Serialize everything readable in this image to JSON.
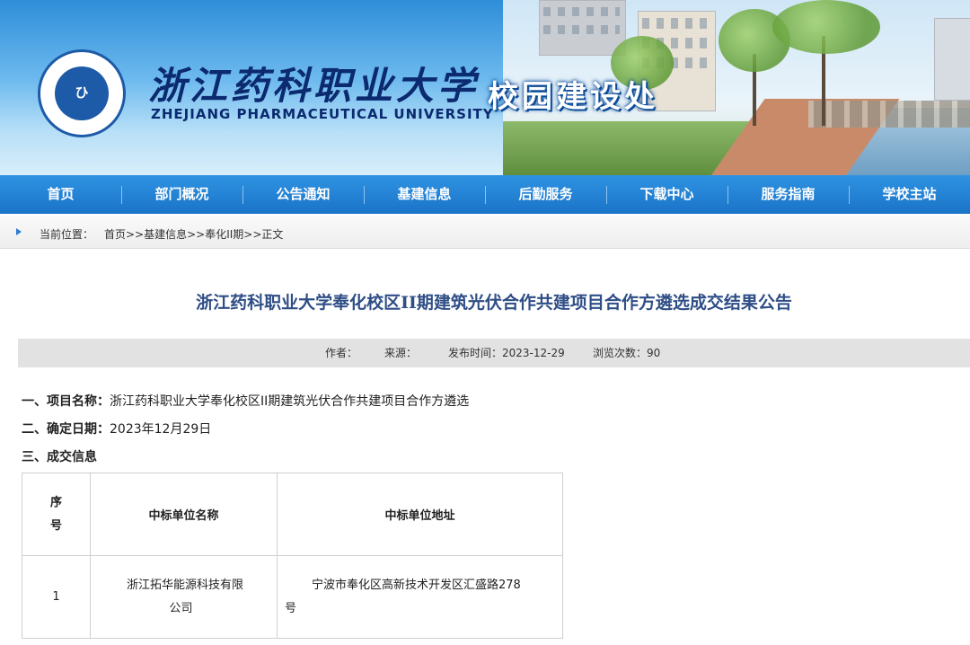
{
  "header": {
    "university_cn": "浙江药科职业大学",
    "university_en": "ZHEJIANG PHARMACEUTICAL UNIVERSITY",
    "department": "校园建设处",
    "logo_icon": "university-seal-icon",
    "colors": {
      "brand_blue": "#0b2a6f",
      "nav_blue": "#1f7ad0",
      "title_blue": "#2f4e86"
    }
  },
  "nav": {
    "items": [
      "首页",
      "部门概况",
      "公告通知",
      "基建信息",
      "后勤服务",
      "下载中心",
      "服务指南",
      "学校主站"
    ]
  },
  "breadcrumb": {
    "label": "当前位置：",
    "path": "首页>>基建信息>>奉化II期>>正文"
  },
  "article": {
    "title": "浙江药科职业大学奉化校区II期建筑光伏合作共建项目合作方遴选成交结果公告",
    "meta": {
      "author": "作者：",
      "source": "来源：",
      "publish": "发布时间：2023-12-29",
      "views": "浏览次数：90"
    },
    "sections": [
      {
        "label": "一、项目名称：",
        "value": "浙江药科职业大学奉化校区II期建筑光伏合作共建项目合作方遴选"
      },
      {
        "label": "二、确定日期：",
        "value": "2023年12月29日"
      },
      {
        "label": "三、成交信息",
        "value": ""
      }
    ],
    "table": {
      "headers": [
        "序号",
        "中标单位名称",
        "中标单位地址"
      ],
      "header_seq_lines": [
        "序",
        "号"
      ],
      "rows": [
        {
          "seq": "1",
          "name_lines": [
            "浙江拓华能源科技有限",
            "公司"
          ],
          "addr_lines": [
            "宁波市奉化区高新技术开发区汇盛路278",
            "号"
          ]
        }
      ]
    }
  }
}
